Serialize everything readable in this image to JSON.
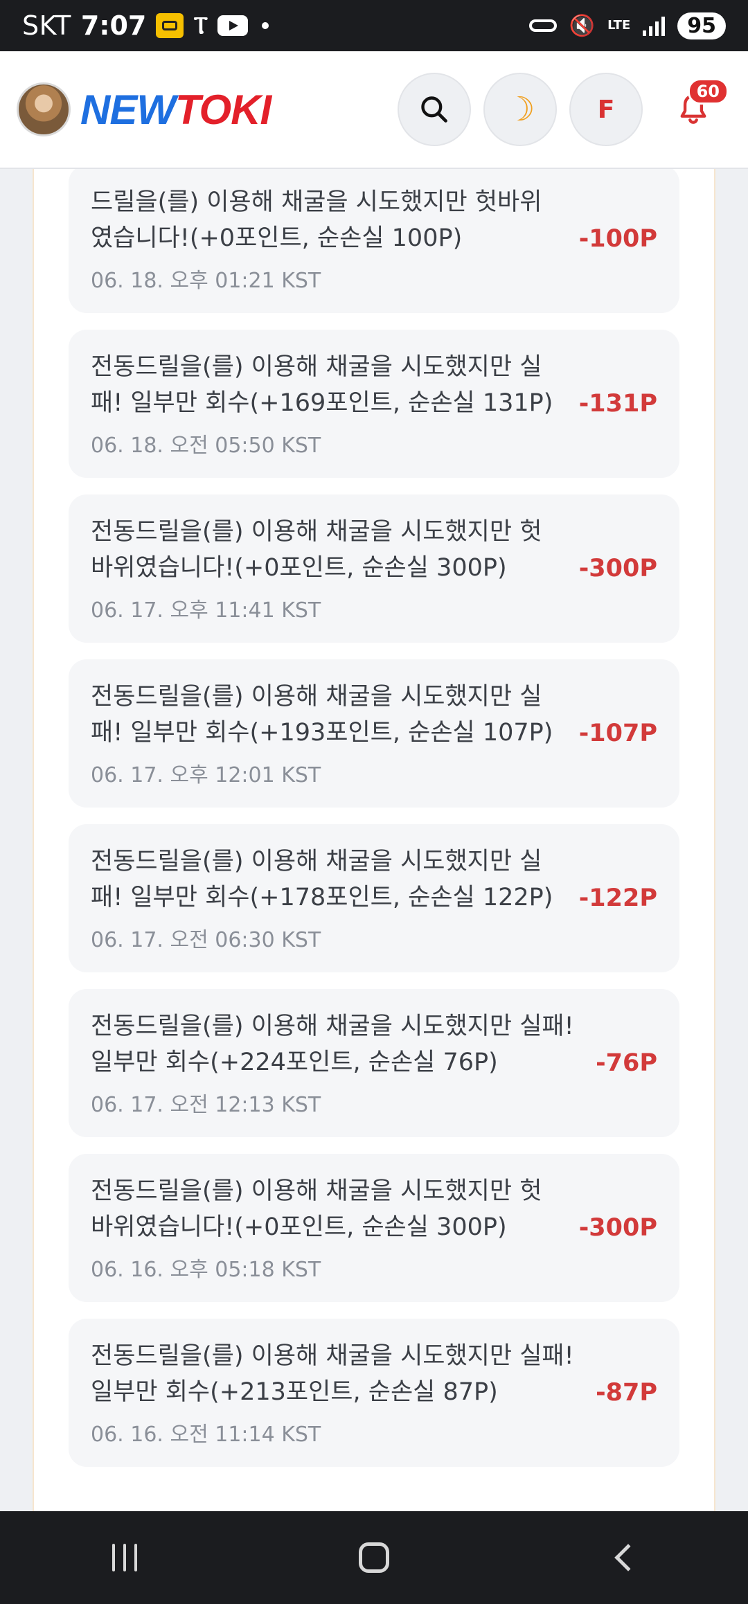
{
  "status_bar": {
    "carrier": "SKT",
    "time": "7:07",
    "network": "LTE",
    "battery": "95"
  },
  "header": {
    "logo_part1": "NEW",
    "logo_part2": "TOKI",
    "profile_initial": "F",
    "notification_count": "60",
    "theme_icon": "☽"
  },
  "transactions": [
    {
      "description": "드릴을(를) 이용해 채굴을 시도했지만 헛바위였습니다!(+0포인트, 순손실 100P)",
      "time": "06. 18. 오후 01:21 KST",
      "amount": "-100P"
    },
    {
      "description": "전동드릴을(를) 이용해 채굴을 시도했지만 실패! 일부만 회수(+169포인트, 순손실 131P)",
      "time": "06. 18. 오전 05:50 KST",
      "amount": "-131P"
    },
    {
      "description": "전동드릴을(를) 이용해 채굴을 시도했지만 헛바위였습니다!(+0포인트, 순손실 300P)",
      "time": "06. 17. 오후 11:41 KST",
      "amount": "-300P"
    },
    {
      "description": "전동드릴을(를) 이용해 채굴을 시도했지만 실패! 일부만 회수(+193포인트, 순손실 107P)",
      "time": "06. 17. 오후 12:01 KST",
      "amount": "-107P"
    },
    {
      "description": "전동드릴을(를) 이용해 채굴을 시도했지만 실패! 일부만 회수(+178포인트, 순손실 122P)",
      "time": "06. 17. 오전 06:30 KST",
      "amount": "-122P"
    },
    {
      "description": "전동드릴을(를) 이용해 채굴을 시도했지만 실패! 일부만 회수(+224포인트, 순손실 76P)",
      "time": "06. 17. 오전 12:13 KST",
      "amount": "-76P"
    },
    {
      "description": "전동드릴을(를) 이용해 채굴을 시도했지만 헛바위였습니다!(+0포인트, 순손실 300P)",
      "time": "06. 16. 오후 05:18 KST",
      "amount": "-300P"
    },
    {
      "description": "전동드릴을(를) 이용해 채굴을 시도했지만 실패! 일부만 회수(+213포인트, 순손실 87P)",
      "time": "06. 16. 오전 11:14 KST",
      "amount": "-87P"
    }
  ],
  "colors": {
    "negative_amount": "#d23a3a",
    "logo_blue": "#1e6fe0",
    "logo_red": "#e3202a"
  }
}
